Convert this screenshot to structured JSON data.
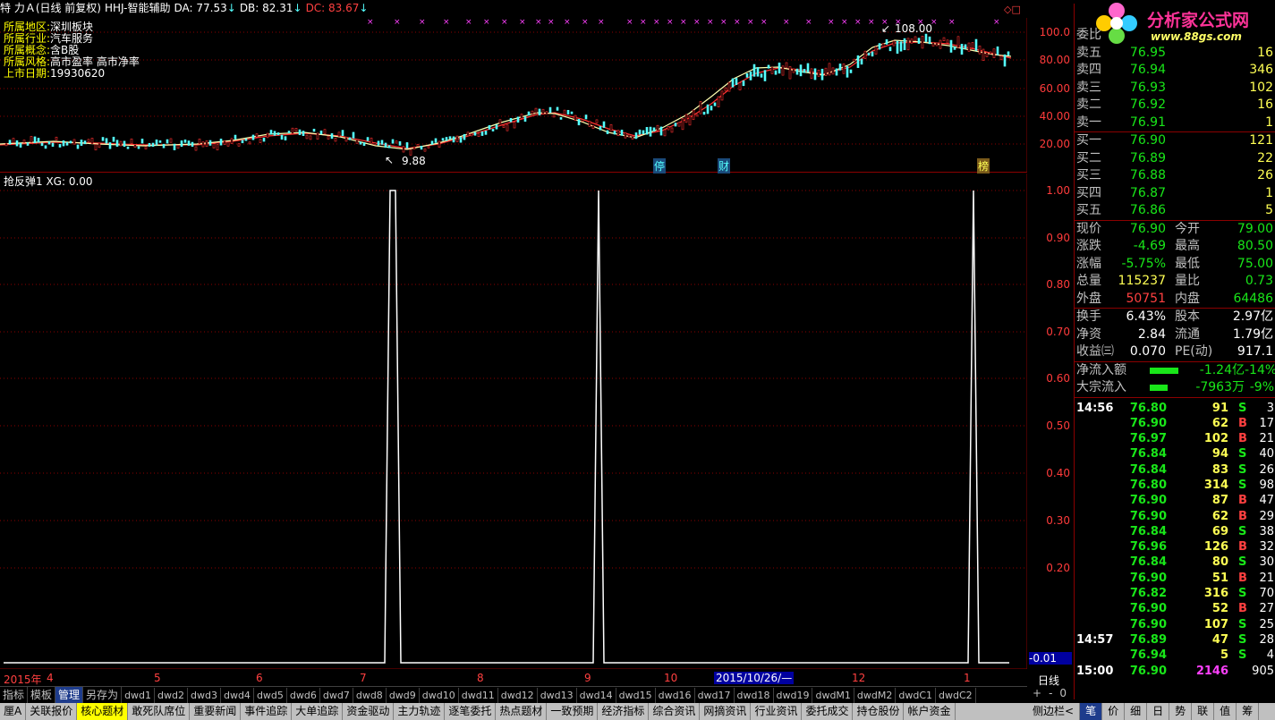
{
  "title_bar": {
    "stock_name": "特 力Ａ(日线 前复权)",
    "indicator": "HHJ-智能辅助",
    "da_label": "DA: 77.53",
    "db_label": "DB: 82.31",
    "dc_label": "DC: 83.67",
    "arrow": "↓"
  },
  "stock_info": {
    "region_label": "所属地区:",
    "region": "深圳板块",
    "industry_label": "所属行业:",
    "industry": "汽车服务",
    "concept_label": "所属概念:",
    "concept": "含B股",
    "style_label": "所属风格:",
    "style": "高市盈率 高市净率",
    "listing_label": "上市日期:",
    "listing_date": "19930620"
  },
  "price_chart": {
    "high_label": "108.00",
    "low_label": "9.88",
    "axis": [
      "100.0",
      "80.00",
      "60.00",
      "40.00",
      "20.00"
    ],
    "events": [
      "停",
      "财",
      "榜"
    ]
  },
  "indicator_panel": {
    "title": "抢反弹1 XG: 0.00",
    "axis": [
      "1.00",
      "0.90",
      "0.80",
      "0.70",
      "0.60",
      "0.50",
      "0.40",
      "0.30",
      "0.20"
    ],
    "current_value": "-0.01",
    "period": "日线"
  },
  "date_axis": {
    "year": "2015年",
    "months": [
      "4",
      "5",
      "6",
      "7",
      "8",
      "9",
      "10",
      "12",
      "1"
    ],
    "cursor_date": "2015/10/26/—"
  },
  "bottom_tabs": {
    "items": [
      "指标",
      "模板",
      "管理",
      "另存为"
    ],
    "active": "管理",
    "formulas": [
      "dwd1",
      "dwd2",
      "dwd3",
      "dwd4",
      "dwd5",
      "dwd6",
      "dwd7",
      "dwd8",
      "dwd9",
      "dwd10",
      "dwd11",
      "dwd12",
      "dwd13",
      "dwd14",
      "dwd15",
      "dwd16",
      "dwd17",
      "dwd18",
      "dwd19",
      "dwdM1",
      "dwdM2",
      "dwdC1",
      "dwdC2"
    ],
    "controls": [
      "+",
      "-",
      "0"
    ]
  },
  "footer": {
    "items": [
      "厘A",
      "关联报价",
      "核心题材",
      "敢死队席位",
      "重要新闻",
      "事件追踪",
      "大单追踪",
      "资金驱动",
      "主力轨迹",
      "逐笔委托",
      "热点题材",
      "一致预期",
      "经济指标",
      "综合资讯",
      "网摘资讯",
      "行业资讯",
      "委托成交",
      "持仓股份",
      "帐户资金"
    ],
    "right": [
      "侧边栏<",
      "笔",
      "价",
      "细",
      "日",
      "势",
      "联",
      "值",
      "筹"
    ]
  },
  "logo": {
    "name": "分析家公式网",
    "url_text": "www.88gs.com"
  },
  "order_book": {
    "header": "委比",
    "asks": [
      {
        "label": "卖五",
        "price": "76.95",
        "vol": "16"
      },
      {
        "label": "卖四",
        "price": "76.94",
        "vol": "346"
      },
      {
        "label": "卖三",
        "price": "76.93",
        "vol": "102"
      },
      {
        "label": "卖二",
        "price": "76.92",
        "vol": "16"
      },
      {
        "label": "卖一",
        "price": "76.91",
        "vol": "1"
      }
    ],
    "bids": [
      {
        "label": "买一",
        "price": "76.90",
        "vol": "121"
      },
      {
        "label": "买二",
        "price": "76.89",
        "vol": "22"
      },
      {
        "label": "买三",
        "price": "76.88",
        "vol": "26"
      },
      {
        "label": "买四",
        "price": "76.87",
        "vol": "1"
      },
      {
        "label": "买五",
        "price": "76.86",
        "vol": "5"
      }
    ]
  },
  "quote": [
    {
      "l1": "现价",
      "v1": "76.90",
      "c1": "green",
      "l2": "今开",
      "v2": "79.00",
      "c2": "green"
    },
    {
      "l1": "涨跌",
      "v1": "-4.69",
      "c1": "green",
      "l2": "最高",
      "v2": "80.50",
      "c2": "green"
    },
    {
      "l1": "涨幅",
      "v1": "-5.75%",
      "c1": "green",
      "l2": "最低",
      "v2": "75.00",
      "c2": "green"
    },
    {
      "l1": "总量",
      "v1": "115237",
      "c1": "yellow",
      "l2": "量比",
      "v2": "0.73",
      "c2": "green"
    },
    {
      "l1": "外盘",
      "v1": "50751",
      "c1": "red",
      "l2": "内盘",
      "v2": "64486",
      "c2": "green"
    }
  ],
  "fundamentals": [
    {
      "l1": "换手",
      "v1": "6.43%",
      "l2": "股本",
      "v2": "2.97亿"
    },
    {
      "l1": "净资",
      "v1": "2.84",
      "l2": "流通",
      "v2": "1.79亿"
    },
    {
      "l1": "收益㈢",
      "v1": "0.070",
      "l2": "PE(动)",
      "v2": "917.1"
    }
  ],
  "flows": [
    {
      "label": "净流入额",
      "value": "-1.24亿",
      "pct": "-14%"
    },
    {
      "label": "大宗流入",
      "value": "-7963万",
      "pct": "-9%"
    }
  ],
  "ticks": [
    {
      "time": "14:56",
      "price": "76.80",
      "vol": "91",
      "side": "S",
      "n": "3"
    },
    {
      "time": "",
      "price": "76.90",
      "vol": "62",
      "side": "B",
      "n": "17"
    },
    {
      "time": "",
      "price": "76.97",
      "vol": "102",
      "side": "B",
      "n": "21"
    },
    {
      "time": "",
      "price": "76.84",
      "vol": "94",
      "side": "S",
      "n": "40"
    },
    {
      "time": "",
      "price": "76.84",
      "vol": "83",
      "side": "S",
      "n": "26"
    },
    {
      "time": "",
      "price": "76.80",
      "vol": "314",
      "side": "S",
      "n": "98"
    },
    {
      "time": "",
      "price": "76.90",
      "vol": "87",
      "side": "B",
      "n": "47"
    },
    {
      "time": "",
      "price": "76.90",
      "vol": "62",
      "side": "B",
      "n": "29"
    },
    {
      "time": "",
      "price": "76.84",
      "vol": "69",
      "side": "S",
      "n": "38"
    },
    {
      "time": "",
      "price": "76.96",
      "vol": "126",
      "side": "B",
      "n": "32"
    },
    {
      "time": "",
      "price": "76.84",
      "vol": "80",
      "side": "S",
      "n": "30"
    },
    {
      "time": "",
      "price": "76.90",
      "vol": "51",
      "side": "B",
      "n": "21"
    },
    {
      "time": "",
      "price": "76.82",
      "vol": "316",
      "side": "S",
      "n": "70"
    },
    {
      "time": "",
      "price": "76.90",
      "vol": "52",
      "side": "B",
      "n": "27"
    },
    {
      "time": "",
      "price": "76.90",
      "vol": "107",
      "side": "S",
      "n": "25"
    },
    {
      "time": "14:57",
      "price": "76.89",
      "vol": "47",
      "side": "S",
      "n": "28"
    },
    {
      "time": "",
      "price": "76.94",
      "vol": "5",
      "side": "S",
      "n": "4"
    },
    {
      "time": "15:00",
      "price": "76.90",
      "vol": "2146",
      "side": "",
      "n": "905"
    }
  ]
}
